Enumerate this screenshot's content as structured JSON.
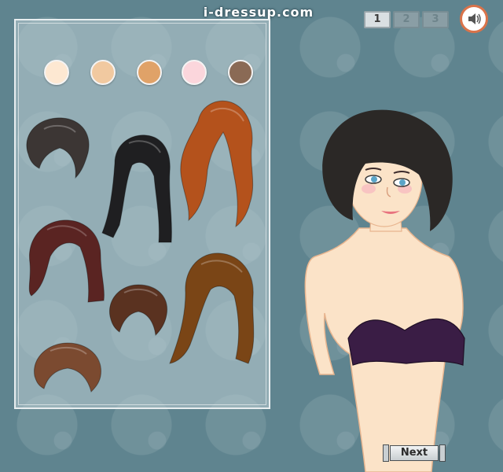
{
  "site": {
    "logo_text": "i-dressup.com"
  },
  "pagination": {
    "pages": [
      "1",
      "2",
      "3"
    ],
    "current": "1"
  },
  "sound": {
    "icon": "speaker-icon"
  },
  "skin_tones": [
    "#fde8d2",
    "#f1c9a0",
    "#e0a268",
    "#fbd6dc",
    "#8a6a55"
  ],
  "hairstyles": [
    {
      "name": "short-wavy-black",
      "color": "#3c3634"
    },
    {
      "name": "long-straight-black",
      "color": "#1f1f21"
    },
    {
      "name": "long-curly-auburn",
      "color": "#b4521c"
    },
    {
      "name": "medium-mahogany",
      "color": "#5a2422"
    },
    {
      "name": "short-messy-brown",
      "color": "#5a3220"
    },
    {
      "name": "long-wavy-brown",
      "color": "#7a4516"
    },
    {
      "name": "bob-chestnut",
      "color": "#7b4a30"
    }
  ],
  "model": {
    "hair_color": "#2b2826",
    "skin_color": "#fbe3c8",
    "top_color": "#3a1d45"
  },
  "next_button": {
    "label": "Next"
  }
}
